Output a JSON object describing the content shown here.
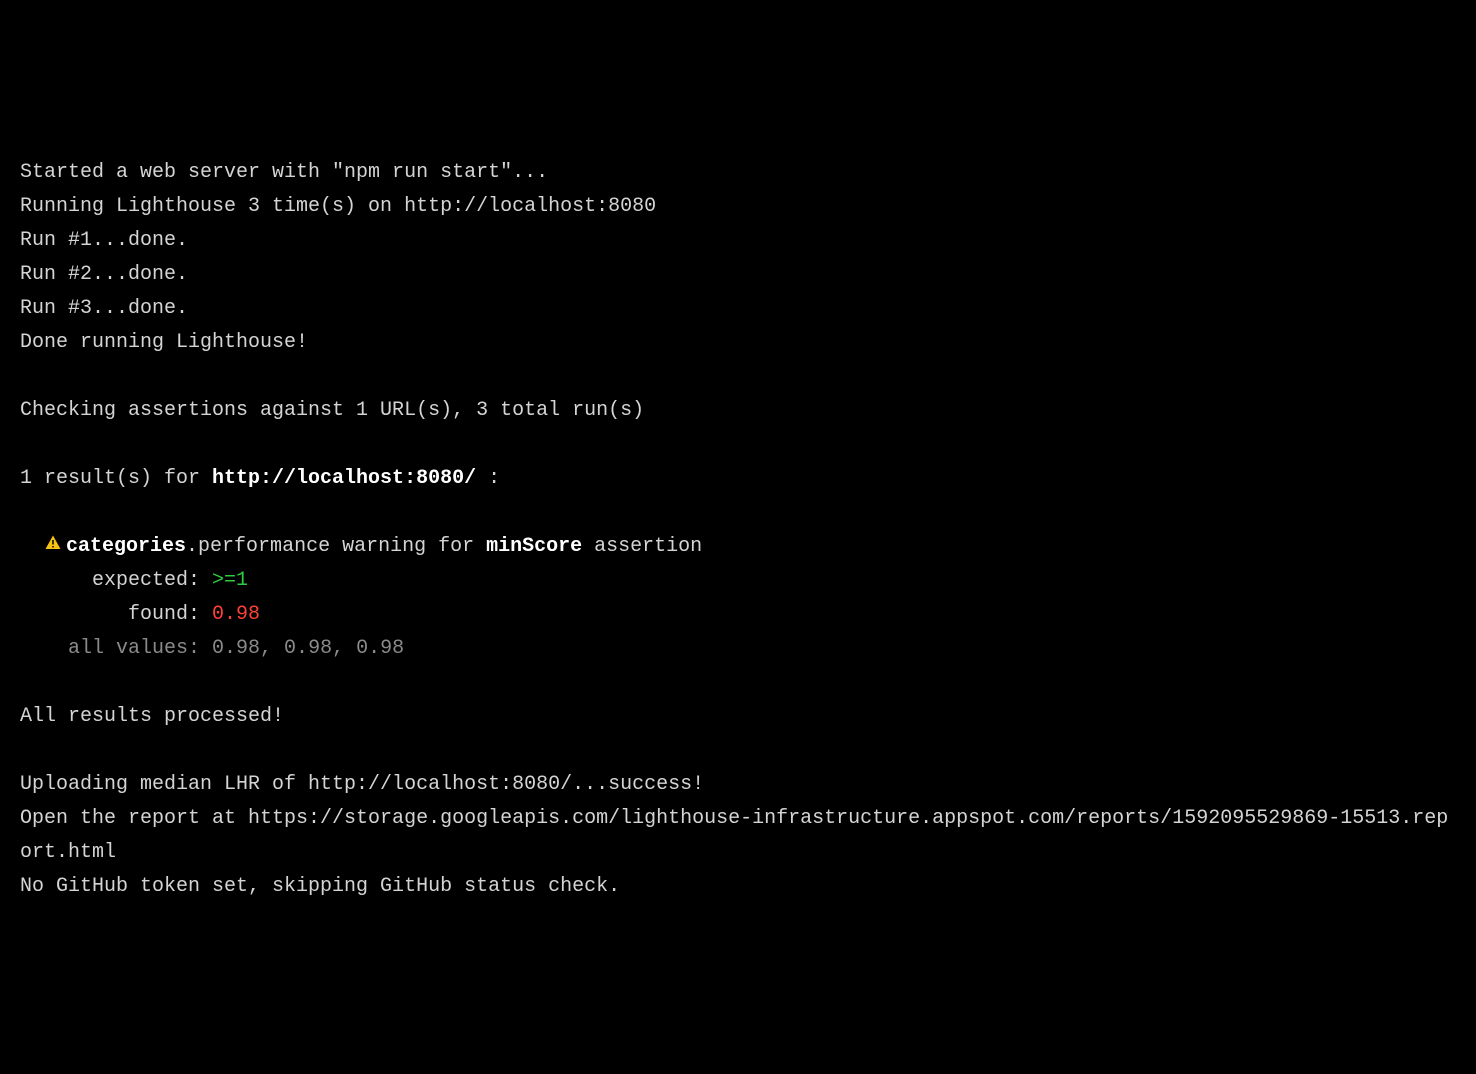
{
  "lines": {
    "started": "Started a web server with \"npm run start\"...",
    "running": "Running Lighthouse 3 time(s) on http://localhost:8080",
    "run1": "Run #1...done.",
    "run2": "Run #2...done.",
    "run3": "Run #3...done.",
    "doneRunning": "Done running Lighthouse!",
    "blank": "",
    "checking": "Checking assertions against 1 URL(s), 3 total run(s)",
    "resultsPrefix": "1 result(s) for ",
    "resultsUrl": "http://localhost:8080/",
    "resultsSuffix": " :",
    "warnIndent": "  ",
    "catBold": "categories",
    "catDot": ".performance warning for ",
    "minScore": "minScore",
    "assertionSuffix": " assertion",
    "expectedLabel": "      expected: ",
    "expectedValue": ">=1",
    "foundLabel": "         found: ",
    "foundValue": "0.98",
    "allValuesLabel": "    all values: ",
    "allValuesValue": "0.98, 0.98, 0.98",
    "allProcessed": "All results processed!",
    "uploading": "Uploading median LHR of http://localhost:8080/...success!",
    "openReport": "Open the report at https://storage.googleapis.com/lighthouse-infrastructure.appspot.com/reports/1592095529869-15513.report.html",
    "noGithub": "No GitHub token set, skipping GitHub status check."
  }
}
